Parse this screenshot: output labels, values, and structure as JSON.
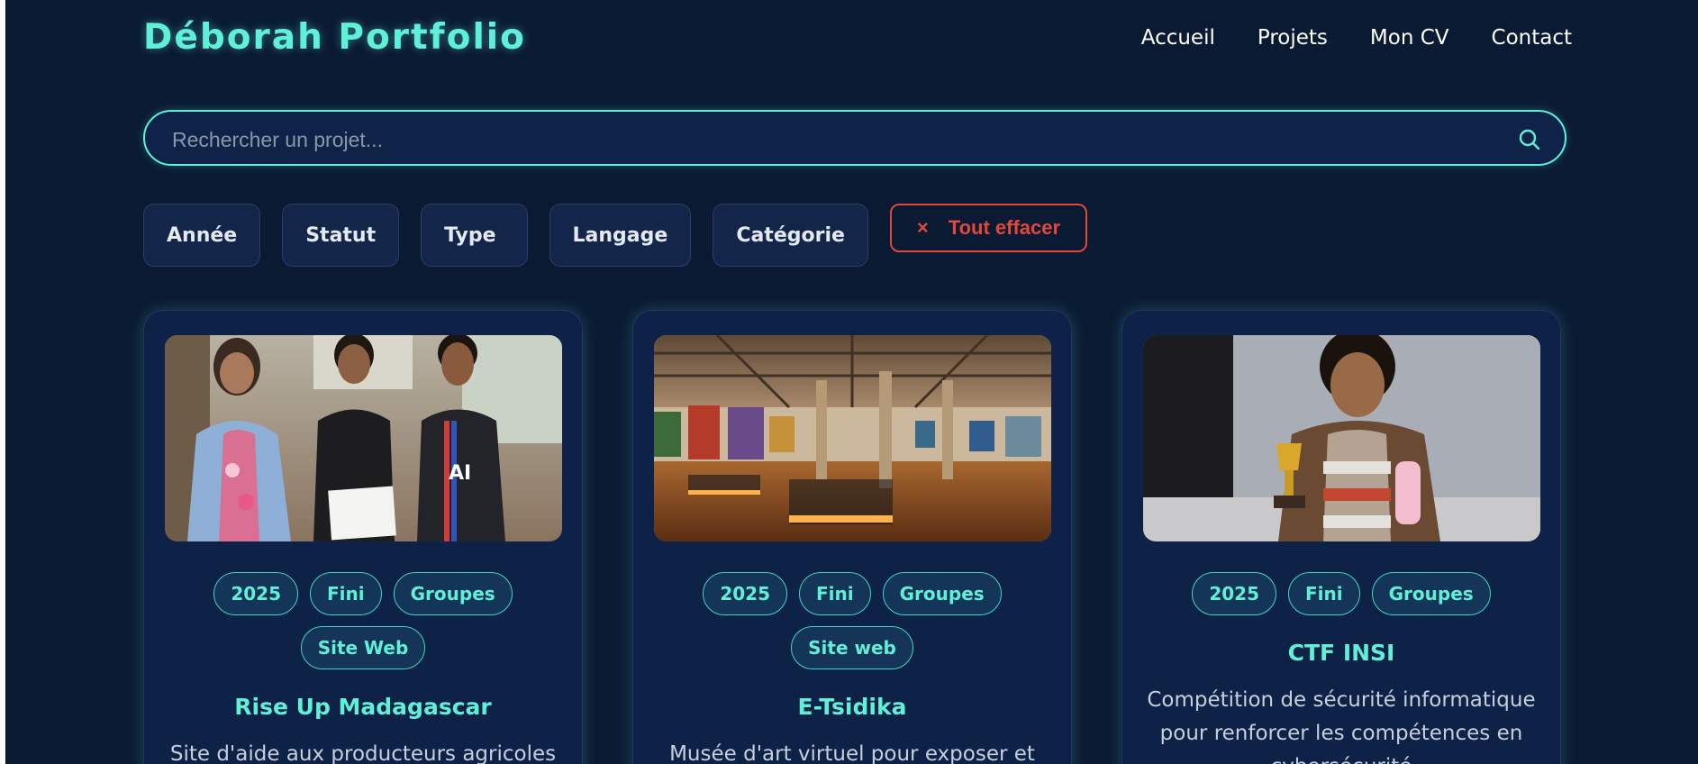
{
  "header": {
    "brand": "Déborah Portfolio",
    "nav": [
      "Accueil",
      "Projets",
      "Mon CV",
      "Contact"
    ]
  },
  "search": {
    "placeholder": "Rechercher un projet...",
    "icon": "search-icon"
  },
  "filters": {
    "items": [
      "Année",
      "Statut",
      "Type",
      "Langage",
      "Catégorie"
    ],
    "clear_label": "Tout effacer",
    "clear_icon": "×"
  },
  "cards": [
    {
      "image": "group-photo",
      "tags": [
        "2025",
        "Fini",
        "Groupes",
        "Site Web"
      ],
      "title": "Rise Up Madagascar",
      "description": "Site d'aide aux producteurs agricoles"
    },
    {
      "image": "museum-hall",
      "tags": [
        "2025",
        "Fini",
        "Groupes",
        "Site web"
      ],
      "title": "E-Tsidika",
      "description": "Musée d'art virtuel pour exposer et"
    },
    {
      "image": "trophy-photo",
      "tags": [
        "2025",
        "Fini",
        "Groupes"
      ],
      "title": "CTF INSI",
      "description": "Compétition de sécurité informatique pour renforcer les compétences en cybersécurité"
    }
  ],
  "colors": {
    "background": "#0a1a33",
    "accent": "#5ff0d8",
    "danger": "#e0483c",
    "card": "#0e2146"
  }
}
